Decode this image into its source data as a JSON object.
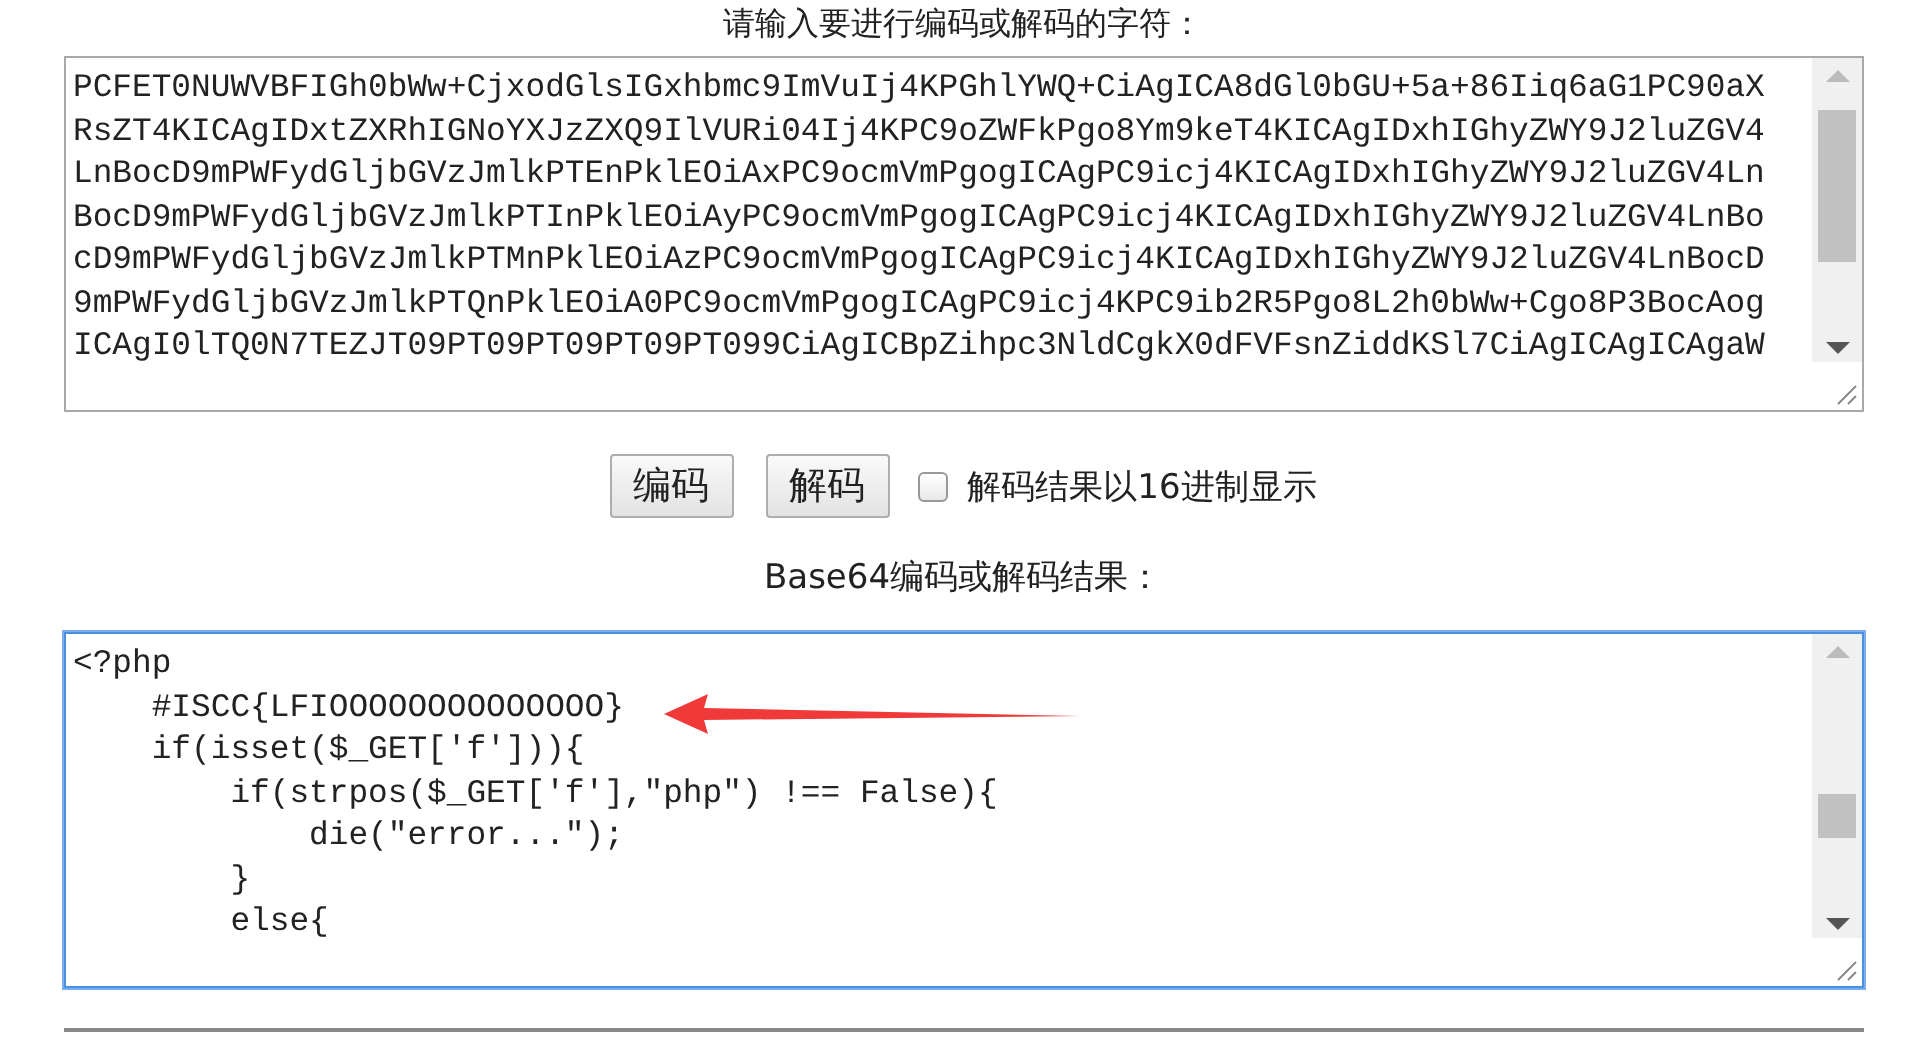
{
  "heading": "请输入要进行编码或解码的字符：",
  "input": {
    "lines": [
      "PCFET0NUWVBFIGh0bWw+CjxodGlsIGxhbmc9ImVuIj4KPGhlYWQ+CiAgICA8dGl0bGU+5a+86Iiq6aG1PC90aX",
      "RsZT4KICAgIDxtZXRhIGNoYXJzZXQ9IlVURi04Ij4KPC9oZWFkPgo8Ym9keT4KICAgIDxhIGhyZWY9J2luZGV4",
      "LnBocD9mPWFydGljbGVzJmlkPTEnPklEOiAxPC9ocmVmPgogICAgPC9icj4KICAgIDxhIGhyZWY9J2luZGV4Ln",
      "BocD9mPWFydGljbGVzJmlkPTInPklEOiAyPC9ocmVmPgogICAgPC9icj4KICAgIDxhIGhyZWY9J2luZGV4LnBo",
      "cD9mPWFydGljbGVzJmlkPTMnPklEOiAzPC9ocmVmPgogICAgPC9icj4KICAgIDxhIGhyZWY9J2luZGV4LnBocD",
      "9mPWFydGljbGVzJmlkPTQnPklEOiA0PC9ocmVmPgogICAgPC9icj4KPC9ib2R5Pgo8L2h0bWw+Cgo8P3BocAog",
      "ICAgI0lTQ0N7TEZJT09PT09PT09PT09PT099CiAgICBpZihpc3NldCgkX0dFVFsnZiddKSl7CiAgICAgICAgaW"
    ],
    "focused": false
  },
  "buttons": [
    "编码",
    "解码"
  ],
  "hex_option": {
    "label": "解码结果以16进制显示",
    "checked": false
  },
  "result_heading": "Base64编码或解码结果：",
  "result": {
    "lines": [
      "<?php",
      "    #ISCC{LFIOOOOOOOOOOOOOO}",
      "    if(isset($_GET['f'])){",
      "        if(strpos($_GET['f'],\"php\") !== False){",
      "            die(\"error...\");",
      "        }",
      "        else{"
    ],
    "focused": true
  }
}
